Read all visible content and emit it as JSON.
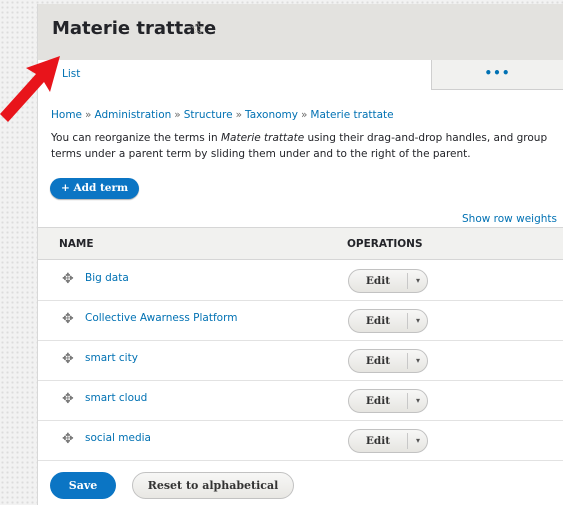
{
  "header": {
    "title": "Materie trattate",
    "star_icon": "star-outline-icon"
  },
  "tabs": {
    "list_label": "List",
    "more_label": "•••"
  },
  "breadcrumb": [
    "Home",
    "Administration",
    "Structure",
    "Taxonomy",
    "Materie trattate"
  ],
  "breadcrumb_sep": "»",
  "description": {
    "part1": "You can reorganize the terms in ",
    "vocab": "Materie trattate",
    "part2": " using their drag-and-drop handles, and group terms under a parent term by sliding them under and to the right of the parent."
  },
  "add_term_label": "+ Add term",
  "show_row_weights": "Show row weights",
  "table": {
    "headers": {
      "name": "NAME",
      "operations": "OPERATIONS"
    },
    "rows": [
      {
        "term": "Big data",
        "edit": "Edit"
      },
      {
        "term": "Collective Awarness Platform",
        "edit": "Edit"
      },
      {
        "term": "smart city",
        "edit": "Edit"
      },
      {
        "term": "smart cloud",
        "edit": "Edit"
      },
      {
        "term": "social media",
        "edit": "Edit"
      }
    ]
  },
  "actions": {
    "save_label": "Save",
    "reset_label": "Reset to alphabetical"
  },
  "colors": {
    "accent": "#0071b3",
    "primary_button": "#0b75c4",
    "annotation_arrow": "#e8141b"
  }
}
